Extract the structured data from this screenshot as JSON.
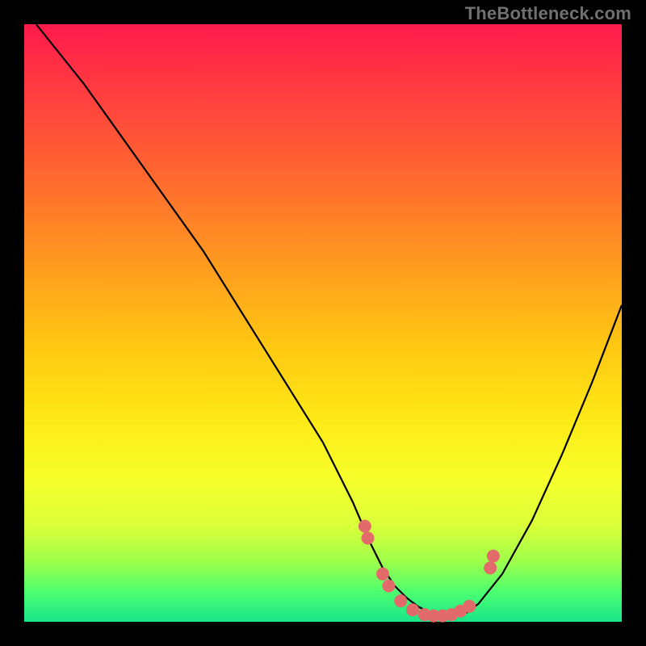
{
  "watermark": "TheBottleneck.com",
  "chart_data": {
    "type": "line",
    "title": "",
    "xlabel": "",
    "ylabel": "",
    "xlim": [
      0,
      100
    ],
    "ylim": [
      0,
      100
    ],
    "series": [
      {
        "name": "curve",
        "x": [
          2,
          10,
          20,
          30,
          40,
          50,
          55,
          58,
          60,
          62,
          64,
          66,
          68,
          70,
          72,
          74,
          76,
          80,
          85,
          90,
          95,
          100
        ],
        "y": [
          100,
          90,
          76,
          62,
          46,
          30,
          20,
          13,
          9,
          6,
          4,
          2.5,
          1.5,
          1,
          1,
          1.5,
          3,
          8,
          17,
          28,
          40,
          53
        ]
      }
    ],
    "markers": {
      "name": "dots",
      "color": "#e26a6a",
      "radius": 8,
      "x": [
        57,
        57.5,
        60,
        61,
        63,
        65,
        67,
        68.5,
        70,
        71.5,
        73,
        74.5,
        78,
        78.5
      ],
      "y": [
        16,
        14,
        8,
        6,
        3.5,
        2,
        1.2,
        1,
        1,
        1.2,
        1.8,
        2.6,
        9,
        11
      ]
    }
  }
}
